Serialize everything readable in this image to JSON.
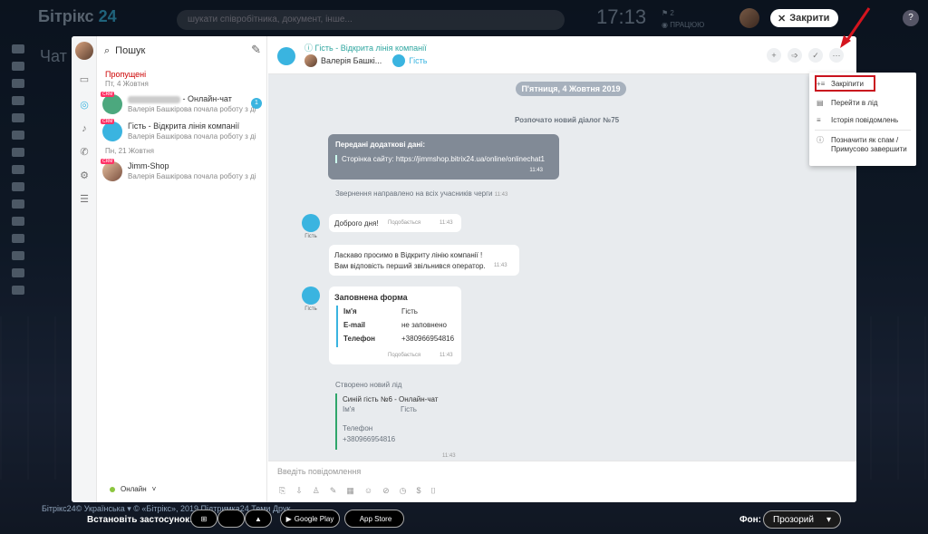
{
  "topbar": {
    "logo_main": "Бітрікс",
    "logo_num": "24",
    "search_placeholder": "шукати співробітника, документ, інше...",
    "clock": "17:13",
    "work_count": "2",
    "work_status": "ПРАЦЮЮ",
    "close_label": "Закрити"
  },
  "page_title": "Чат і",
  "sidebar": {
    "search_label": "Пошук",
    "missed_title": "Пропущені",
    "date1": "Пт, 4 Жовтня",
    "date2": "Пн, 21 Жовтня",
    "chats": [
      {
        "name": "- Онлайн-чат",
        "preview": "Валерія Башкірова почала роботу з ді",
        "badge": "1"
      },
      {
        "name": "Гість - Відкрита лінія компанії",
        "preview": "Валерія Башкірова почала роботу з ді"
      },
      {
        "name": "Jimm-Shop",
        "preview": "Валерія Башкірова почала роботу з ді"
      }
    ],
    "status": "Онлайн"
  },
  "header": {
    "title": "Гість - Відкрита лінія компанії",
    "member1": "Валерія Башкі...",
    "member2": "Гість"
  },
  "feed": {
    "date": "П'ятниця, 4 Жовтня 2019",
    "new_dialog": "Розпочато новий діалог №75",
    "extra_title": "Передані додаткові дані:",
    "extra_text": "Сторінка сайту: https://jimmshop.bitrix24.ua/online/onlinechat1",
    "extra_time": "11:43",
    "routed": "Звернення направлено на всіх учасників черги",
    "routed_time": "11:43",
    "guest_label": "Гість",
    "msg1": "Доброго дня!",
    "like": "Подобається",
    "msg1_time": "11:43",
    "msg2_line1": "Ласкаво просимо в Відкриту лінію компанії !",
    "msg2_line2": "Вам відповість перший звільнився оператор.",
    "msg2_time": "11:43",
    "form_title": "Заповнена форма",
    "form_rows": [
      {
        "label": "Ім'я",
        "value": "Гість"
      },
      {
        "label": "E-mail",
        "value": "не заповнено"
      },
      {
        "label": "Телефон",
        "value": "+380966954816"
      }
    ],
    "form_time": "11:43",
    "lead_title": "Створено новий лід",
    "lead_name": "Синій гість №6 - Онлайн-чат",
    "lead_name_label": "Ім'я",
    "lead_name_value": "Гість",
    "lead_phone_label": "Телефон",
    "lead_phone_value": "+380966954816",
    "lead_time": "11:43"
  },
  "input": {
    "placeholder": "Введіть повідомлення"
  },
  "menu": {
    "items": [
      "Закріпити",
      "Перейти в лід",
      "Історія повідомлень",
      "Позначити як спам /",
      "Примусово завершити"
    ]
  },
  "footer": {
    "links": "Бітрікс24©   Українська ▾   © «Бітрікс», 2019   Підтримка24   Теми   Друк",
    "install": "Встановіть застосунок:",
    "google": "Google Play",
    "apple": "App Store",
    "bg_label": "Фон:",
    "bg_value": "Прозорий"
  },
  "colors": {
    "accent": "#3ab4e0",
    "highlight": "#c9131e",
    "missed": "#cc0000",
    "online": "#8cc63f"
  }
}
